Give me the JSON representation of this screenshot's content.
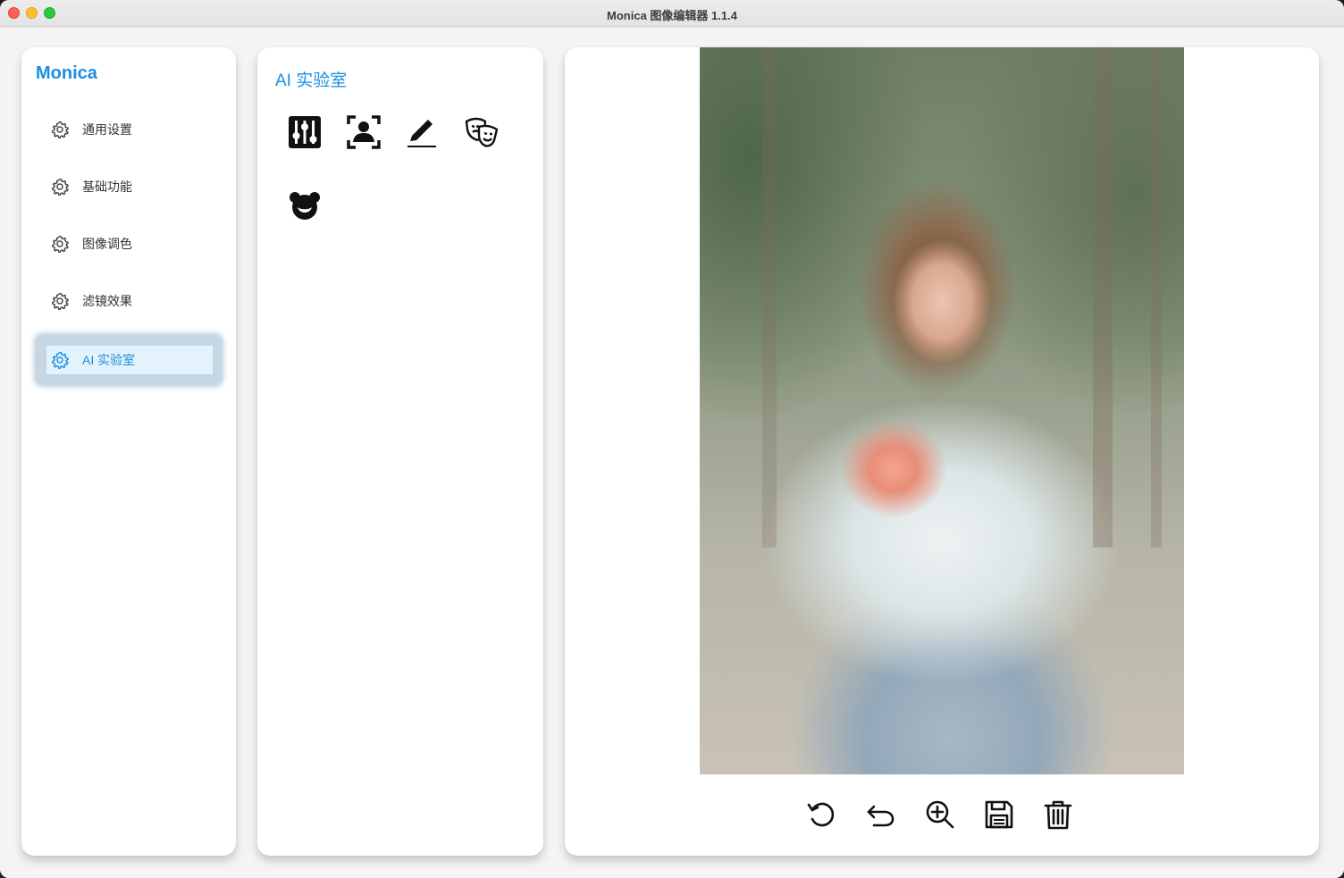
{
  "window": {
    "title": "Monica 图像编辑器 1.1.4"
  },
  "sidebar": {
    "brand": "Monica",
    "items": [
      {
        "label": "通用设置",
        "icon": "gear-icon"
      },
      {
        "label": "基础功能",
        "icon": "gear-icon"
      },
      {
        "label": "图像调色",
        "icon": "gear-icon"
      },
      {
        "label": "滤镜效果",
        "icon": "gear-icon"
      },
      {
        "label": "AI 实验室",
        "icon": "gear-icon",
        "active": true
      }
    ]
  },
  "tools_panel": {
    "title": "AI 实验室",
    "tools": [
      {
        "icon": "sliders-icon"
      },
      {
        "icon": "face-detect-icon"
      },
      {
        "icon": "pencil-icon"
      },
      {
        "icon": "theater-masks-icon"
      },
      {
        "icon": "bear-icon"
      }
    ]
  },
  "viewer": {
    "image": "portrait-photo",
    "toolbar": [
      {
        "icon": "rotate-icon"
      },
      {
        "icon": "undo-icon"
      },
      {
        "icon": "zoom-in-icon"
      },
      {
        "icon": "save-icon"
      },
      {
        "icon": "delete-icon"
      }
    ]
  },
  "colors": {
    "accent": "#1a8fe0",
    "active_bg": "#e4f2fb"
  }
}
